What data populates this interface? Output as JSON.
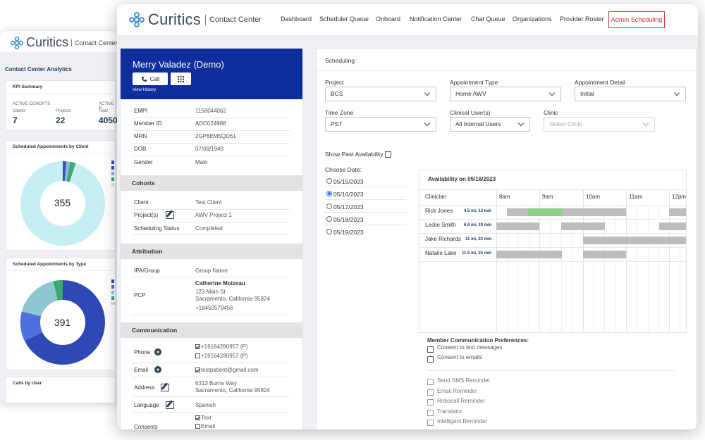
{
  "brand": {
    "name": "Curitics",
    "subtitle": "Contact Center"
  },
  "back": {
    "title": "Contact Center Analytics",
    "kpi": {
      "title": "KPI Summary",
      "active_cohorts": "ACTIVE COHORTS",
      "active_other": "ACTIVE P",
      "clients_label": "Clients",
      "clients_value": "7",
      "projects_label": "Projects",
      "projects_value": "22",
      "total_label": "Total",
      "total_value": "4050"
    },
    "by_client": {
      "title": "Scheduled Appointments by Client",
      "total": "355"
    },
    "by_type": {
      "title": "Scheduled Appointments by Type",
      "total": "391",
      "legend_hint": "Tel"
    },
    "calls": {
      "title": "Calls by User"
    }
  },
  "nav": {
    "items": [
      "Dashboard",
      "Scheduler Queue",
      "Onboard",
      "Notification Center",
      "Chat Queue",
      "Organizations",
      "Provider Roster"
    ],
    "active": "Admin Scheduling"
  },
  "patient": {
    "name": "Merry Valadez (Demo)",
    "call_label": "Call",
    "view_history": "View History",
    "fields": [
      {
        "label": "EMPI",
        "value": "1158044062"
      },
      {
        "label": "Member ID",
        "value": "ADC024988"
      },
      {
        "label": "MRN",
        "value": "2GP6EM5QD61"
      },
      {
        "label": "DOB",
        "value": "07/08/1949"
      },
      {
        "label": "Gender",
        "value": "Male"
      }
    ],
    "cohorts_title": "Cohorts",
    "cohorts": {
      "client_label": "Client",
      "client_value": "Test Client",
      "projects_label": "Project(s)",
      "projects_value": "AWV Project 1",
      "status_label": "Scheduling Status",
      "status_value": "Completed"
    },
    "attribution_title": "Attribution",
    "attribution": {
      "ipa_label": "IPA/Group",
      "ipa_value": "Group Name",
      "pcp_label": "PCP",
      "pcp_name": "Catherine Moizeau",
      "pcp_street": "123 Main St",
      "pcp_city": "Sacramento, California 95824",
      "pcp_phone": "+18450579456"
    },
    "communication_title": "Communication",
    "communication": {
      "phone_label": "Phone",
      "phone1": "+19164280957 (P)",
      "phone2": "+19164280957 (P)",
      "email_label": "Email",
      "email_value": "testpatient@gmail.com",
      "address_label": "Address",
      "address_street": "6313 Burns Way",
      "address_city": "Sacramento, California 95824",
      "language_label": "Language",
      "language_value": "Spanish",
      "consents_label": "Consents",
      "consent_text": "Text",
      "consent_email": "Email"
    }
  },
  "scheduling": {
    "title": "Scheduling",
    "project_label": "Project",
    "project_value": "BCS",
    "appt_type_label": "Appointment Type",
    "appt_type_value": "Home AWV",
    "appt_detail_label": "Appointment Detail",
    "appt_detail_value": "Initial",
    "timezone_label": "Time Zone",
    "timezone_value": "PST",
    "clinical_label": "Clinical User(s)",
    "clinical_value": "All Internal Users",
    "clinic_label": "Clinic",
    "clinic_placeholder": "Select Clinic",
    "show_past": "Show Past Availability",
    "choose_date": "Choose Date:",
    "dates": [
      "05/15/2023",
      "05/16/2023",
      "05/17/2023",
      "05/18/2023",
      "05/19/2023"
    ],
    "selected_date_index": 1,
    "availability_title": "Availability on 05/16/2023",
    "clinician_header": "Clinician",
    "hours": [
      "8am",
      "9am",
      "10am",
      "11am",
      "12pm"
    ],
    "clinicians": [
      {
        "name": "Rick Jones",
        "distance": "4.5 mi, 13 min"
      },
      {
        "name": "Leslie Smith",
        "distance": "6.8 mi, 19 min"
      },
      {
        "name": "Jake Richards",
        "distance": "11 mi, 23 min"
      },
      {
        "name": "Natalie Lake",
        "distance": "11.5 mi, 24 min"
      }
    ],
    "prefs_title": "Member Communication Preferences:",
    "prefs": [
      "Consent to text messages",
      "Consent to emails"
    ],
    "reminders": [
      "Send SMS Reminder",
      "Email Reminder",
      "Robocall Reminder",
      "Translator",
      "Intelligent Reminder"
    ]
  },
  "colors": {
    "header_blue": "#0d2e9c",
    "accent_red": "#d93434",
    "avail_green": "#8fd18a",
    "busy_gray": "#bdbdbd"
  }
}
